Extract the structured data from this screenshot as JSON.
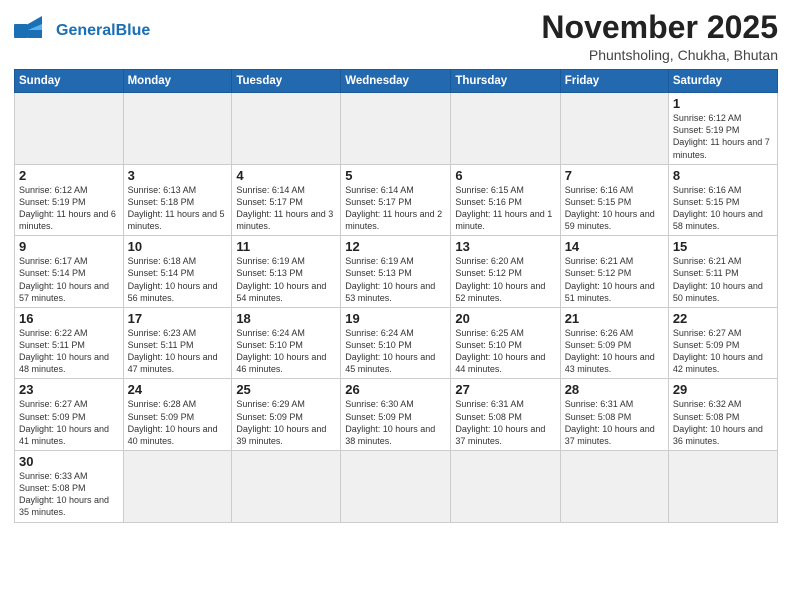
{
  "header": {
    "logo_general": "General",
    "logo_blue": "Blue",
    "month": "November 2025",
    "location": "Phuntsholing, Chukha, Bhutan"
  },
  "weekdays": [
    "Sunday",
    "Monday",
    "Tuesday",
    "Wednesday",
    "Thursday",
    "Friday",
    "Saturday"
  ],
  "weeks": [
    [
      {
        "day": "",
        "info": ""
      },
      {
        "day": "",
        "info": ""
      },
      {
        "day": "",
        "info": ""
      },
      {
        "day": "",
        "info": ""
      },
      {
        "day": "",
        "info": ""
      },
      {
        "day": "",
        "info": ""
      },
      {
        "day": "1",
        "info": "Sunrise: 6:12 AM\nSunset: 5:19 PM\nDaylight: 11 hours\nand 7 minutes."
      }
    ],
    [
      {
        "day": "2",
        "info": "Sunrise: 6:12 AM\nSunset: 5:19 PM\nDaylight: 11 hours\nand 6 minutes."
      },
      {
        "day": "3",
        "info": "Sunrise: 6:13 AM\nSunset: 5:18 PM\nDaylight: 11 hours\nand 5 minutes."
      },
      {
        "day": "4",
        "info": "Sunrise: 6:14 AM\nSunset: 5:17 PM\nDaylight: 11 hours\nand 3 minutes."
      },
      {
        "day": "5",
        "info": "Sunrise: 6:14 AM\nSunset: 5:17 PM\nDaylight: 11 hours\nand 2 minutes."
      },
      {
        "day": "6",
        "info": "Sunrise: 6:15 AM\nSunset: 5:16 PM\nDaylight: 11 hours\nand 1 minute."
      },
      {
        "day": "7",
        "info": "Sunrise: 6:16 AM\nSunset: 5:15 PM\nDaylight: 10 hours\nand 59 minutes."
      },
      {
        "day": "8",
        "info": "Sunrise: 6:16 AM\nSunset: 5:15 PM\nDaylight: 10 hours\nand 58 minutes."
      }
    ],
    [
      {
        "day": "9",
        "info": "Sunrise: 6:17 AM\nSunset: 5:14 PM\nDaylight: 10 hours\nand 57 minutes."
      },
      {
        "day": "10",
        "info": "Sunrise: 6:18 AM\nSunset: 5:14 PM\nDaylight: 10 hours\nand 56 minutes."
      },
      {
        "day": "11",
        "info": "Sunrise: 6:19 AM\nSunset: 5:13 PM\nDaylight: 10 hours\nand 54 minutes."
      },
      {
        "day": "12",
        "info": "Sunrise: 6:19 AM\nSunset: 5:13 PM\nDaylight: 10 hours\nand 53 minutes."
      },
      {
        "day": "13",
        "info": "Sunrise: 6:20 AM\nSunset: 5:12 PM\nDaylight: 10 hours\nand 52 minutes."
      },
      {
        "day": "14",
        "info": "Sunrise: 6:21 AM\nSunset: 5:12 PM\nDaylight: 10 hours\nand 51 minutes."
      },
      {
        "day": "15",
        "info": "Sunrise: 6:21 AM\nSunset: 5:11 PM\nDaylight: 10 hours\nand 50 minutes."
      }
    ],
    [
      {
        "day": "16",
        "info": "Sunrise: 6:22 AM\nSunset: 5:11 PM\nDaylight: 10 hours\nand 48 minutes."
      },
      {
        "day": "17",
        "info": "Sunrise: 6:23 AM\nSunset: 5:11 PM\nDaylight: 10 hours\nand 47 minutes."
      },
      {
        "day": "18",
        "info": "Sunrise: 6:24 AM\nSunset: 5:10 PM\nDaylight: 10 hours\nand 46 minutes."
      },
      {
        "day": "19",
        "info": "Sunrise: 6:24 AM\nSunset: 5:10 PM\nDaylight: 10 hours\nand 45 minutes."
      },
      {
        "day": "20",
        "info": "Sunrise: 6:25 AM\nSunset: 5:10 PM\nDaylight: 10 hours\nand 44 minutes."
      },
      {
        "day": "21",
        "info": "Sunrise: 6:26 AM\nSunset: 5:09 PM\nDaylight: 10 hours\nand 43 minutes."
      },
      {
        "day": "22",
        "info": "Sunrise: 6:27 AM\nSunset: 5:09 PM\nDaylight: 10 hours\nand 42 minutes."
      }
    ],
    [
      {
        "day": "23",
        "info": "Sunrise: 6:27 AM\nSunset: 5:09 PM\nDaylight: 10 hours\nand 41 minutes."
      },
      {
        "day": "24",
        "info": "Sunrise: 6:28 AM\nSunset: 5:09 PM\nDaylight: 10 hours\nand 40 minutes."
      },
      {
        "day": "25",
        "info": "Sunrise: 6:29 AM\nSunset: 5:09 PM\nDaylight: 10 hours\nand 39 minutes."
      },
      {
        "day": "26",
        "info": "Sunrise: 6:30 AM\nSunset: 5:09 PM\nDaylight: 10 hours\nand 38 minutes."
      },
      {
        "day": "27",
        "info": "Sunrise: 6:31 AM\nSunset: 5:08 PM\nDaylight: 10 hours\nand 37 minutes."
      },
      {
        "day": "28",
        "info": "Sunrise: 6:31 AM\nSunset: 5:08 PM\nDaylight: 10 hours\nand 37 minutes."
      },
      {
        "day": "29",
        "info": "Sunrise: 6:32 AM\nSunset: 5:08 PM\nDaylight: 10 hours\nand 36 minutes."
      }
    ],
    [
      {
        "day": "30",
        "info": "Sunrise: 6:33 AM\nSunset: 5:08 PM\nDaylight: 10 hours\nand 35 minutes."
      },
      {
        "day": "",
        "info": ""
      },
      {
        "day": "",
        "info": ""
      },
      {
        "day": "",
        "info": ""
      },
      {
        "day": "",
        "info": ""
      },
      {
        "day": "",
        "info": ""
      },
      {
        "day": "",
        "info": ""
      }
    ]
  ]
}
